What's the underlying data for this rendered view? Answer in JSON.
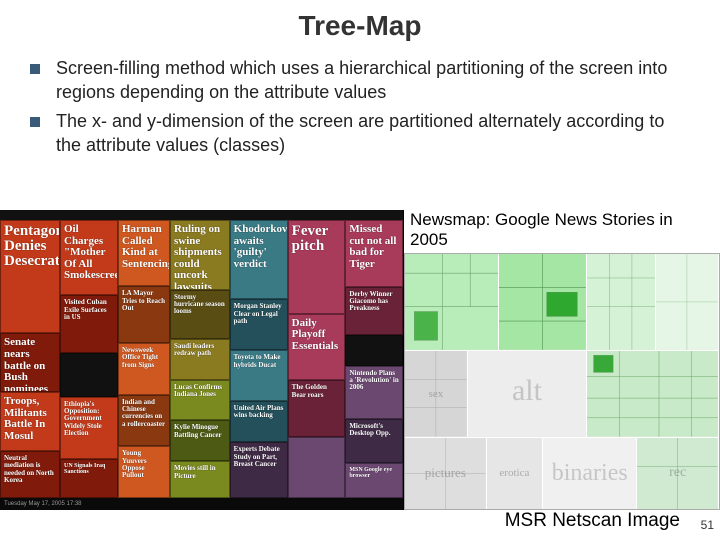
{
  "title": "Tree-Map",
  "bullets": [
    "Screen-filling method which uses a hierarchical partitioning of the screen into regions depending on the attribute values",
    "The x- and y-dimension of the screen are partitioned alternately according to the attribute values (classes)"
  ],
  "caption_top": "Newsmap: Google News Stories in 2005",
  "caption_bottom": "MSR Netscan Image",
  "page_number": "51",
  "newsmap_footer": "Tuesday May 17, 2005 17:38",
  "newsmap_cells": {
    "a1": "Pentagon Denies Desecration",
    "a2": "Senate nears battle on Bush nominees",
    "a3": "Troops, Militants Battle In Mosul",
    "a4": "Neutral mediation is needed on North Korea",
    "b1": "Oil Charges \"Mother Of All Smokescreens\"",
    "b2": "Visited Cuban Exile Surfaces in US",
    "b3": "Ethiopia's Opposition: Government Widely Stole Election",
    "b4": "UN Signals Iraq Sanctions",
    "c1": "Harman Called Kind at Sentencing",
    "c2": "LA Mayor Tries to Reach Out",
    "c3": "Newsweek Office Tight from Signs",
    "c4": "Indian and Chinese currencies on a rollercoaster",
    "c5": "Young Yuuvers Oppose Pullout",
    "d1": "Ruling on swine shipments could uncork lawsuits",
    "d2": "Stormy hurricane season looms",
    "d3": "Saudi leaders redraw path",
    "d4": "Lucas Confirms Indiana Jones",
    "d5": "Kylie Minogue Battling Cancer",
    "d6": "Movies still in Picture",
    "e1": "Khodorkovsky awaits 'guilty' verdict",
    "e2": "Morgan Stanley Clear on Legal path",
    "e3": "Toyota to Make hybrids Ducat",
    "e4": "United Air Plans wins backing",
    "e5": "Experts Debate Study on Part, Breast Cancer",
    "f1": "Fever pitch",
    "f2": "Daily Playoff Essentials",
    "f3": "The Golden Bear roars",
    "g1": "Missed cut not all bad for Tiger",
    "g2": "Derby Winner Giacomo has Preakness",
    "g3": "Nintendo Plans a 'Revolution' in 2006",
    "g4": "Microsoft's Desktop Opp.",
    "g5": "MSN Google eye browser"
  },
  "netscan_labels": {
    "big1": "alt",
    "big2": "binaries",
    "l1": "sex",
    "l2": "pictures",
    "l3": "erotica",
    "l4": "rec"
  }
}
